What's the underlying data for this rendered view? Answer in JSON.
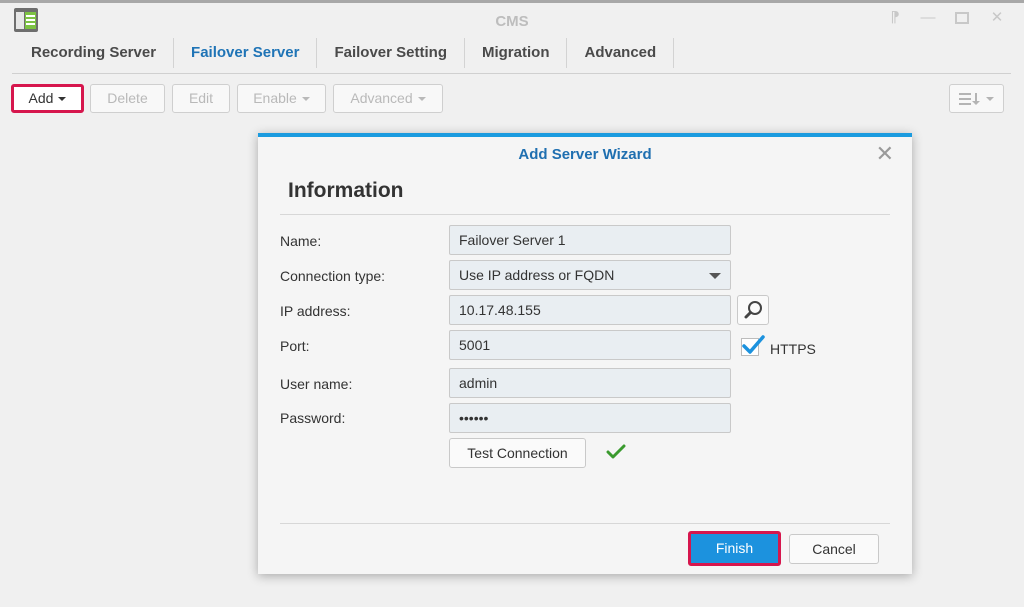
{
  "window": {
    "title": "CMS",
    "icon": "cms-app-icon",
    "controls": [
      "pin-icon",
      "minimize-icon",
      "maximize-icon",
      "close-icon"
    ]
  },
  "tabs": [
    {
      "label": "Recording Server",
      "active": false
    },
    {
      "label": "Failover Server",
      "active": true
    },
    {
      "label": "Failover Setting",
      "active": false
    },
    {
      "label": "Migration",
      "active": false
    },
    {
      "label": "Advanced",
      "active": false
    }
  ],
  "toolbar": {
    "add": "Add",
    "delete": "Delete",
    "edit": "Edit",
    "enable": "Enable",
    "advanced": "Advanced",
    "sort_icon": "sort-list-icon"
  },
  "dialog": {
    "title": "Add Server Wizard",
    "section": "Information",
    "fields": {
      "name": {
        "label": "Name:",
        "value": "Failover Server 1"
      },
      "connection_type": {
        "label": "Connection type:",
        "value": "Use IP address or FQDN"
      },
      "ip_address": {
        "label": "IP address:",
        "value": "10.17.48.155"
      },
      "port": {
        "label": "Port:",
        "value": "5001"
      },
      "user_name": {
        "label": "User name:",
        "value": "admin"
      },
      "password": {
        "label": "Password:",
        "value": "••••••"
      }
    },
    "https": {
      "label": "HTTPS",
      "checked": true
    },
    "test_connection": "Test Connection",
    "test_status": "success",
    "finish": "Finish",
    "cancel": "Cancel"
  },
  "colors": {
    "accent": "#1c92de",
    "active_tab": "#1f74b6",
    "highlight": "#d6164d",
    "success": "#3a9a2e"
  }
}
